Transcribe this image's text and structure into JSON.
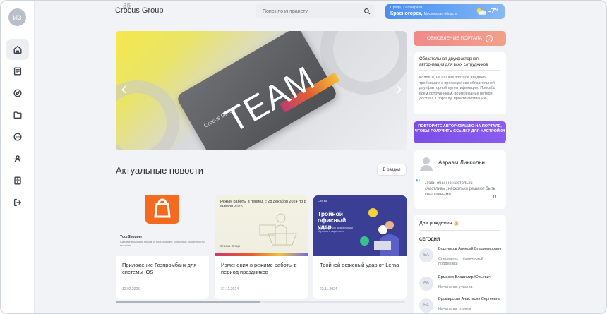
{
  "user": {
    "initials": "ИЗ"
  },
  "sidebar": {
    "items": [
      {
        "icon": "home-icon"
      },
      {
        "icon": "news-icon"
      },
      {
        "icon": "compass-icon"
      },
      {
        "icon": "folder-icon"
      },
      {
        "icon": "chat-icon"
      },
      {
        "icon": "users-icon"
      },
      {
        "icon": "directory-icon"
      },
      {
        "icon": "logout-icon"
      }
    ]
  },
  "header": {
    "logo_text": "Crocus Group",
    "logo_number": "35",
    "search_placeholder": "Поиск по интранету",
    "weather": {
      "date": "Среда, 12 февраля",
      "city": "Красногорск,",
      "region": "Московская область",
      "temp": "-7°"
    }
  },
  "banner": {
    "headline": "TEAM",
    "brand": "Crocus Group"
  },
  "news": {
    "title": "Актуальные новости",
    "section_button": "В раздел",
    "cards": [
      {
        "title": "Приложение Газпромбанк для системы iOS",
        "date": "12.02.2025",
        "image_brand": "YourShopper",
        "image_text": "Сделайте шопинг проще с YourShopper! Ключевые особенности: ssaob.ru"
      },
      {
        "title": "Изменения в режиме работы в период праздников",
        "date": "27.12.2024",
        "image_text": "Режим работы в период с 28 декабря 2024 по 8 января 2025",
        "image_brand": "Crocus Group"
      },
      {
        "title": "Тройной офисный удар от Lerna",
        "date": "22.11.2024",
        "image_brand": "Lerna",
        "image_headline": "Тройной офисный удар",
        "image_text": "Прокачайте soft skills и навыки обучения и маркетинга"
      }
    ]
  },
  "right": {
    "update_button": "ОБНОВЛЕНИЕ ПОРТАЛА",
    "notice": {
      "heading": "Обязательная двухфакторная авторизация для всех сотрудников",
      "body": "Коллеги, на нашем портале введено требование к прохождению обязательной двухфакторной аутентификации. Просьба всем сотрудникам, во избежание потери доступа к порталу, пройти активацию."
    },
    "retry_button": "ПОВТОРИТЕ АВТОРИЗАЦИЮ НА ПОРТАЛЕ, ЧТОБЫ ПОЛУЧИТЬ ССЫЛКУ ДЛЯ НАСТРОЙКИ",
    "quote": {
      "author": "Авраам Линкольн",
      "text": "Люди обычно настолько счастливы, насколько решают быть счастливыми"
    },
    "birthdays": {
      "title": "Дни рождения 🎂",
      "today_label": "СЕГОДНЯ",
      "people": [
        {
          "initials": "БА",
          "name": "Бортников Алексей Владимирович",
          "role": "Специалист технической поддержки"
        },
        {
          "initials": "ЕВ",
          "name": "Ермаков Владимир Юрьевич",
          "role": "Начальник участка"
        },
        {
          "initials": "БА",
          "name": "Бромирская Анастасия Сергеевна",
          "role": "Начальник отдела"
        }
      ]
    }
  },
  "colors": {
    "weather_accent": "#4b8ef0",
    "update_button": "#f08a8a",
    "retry_button": "#7b4ee6",
    "quote_mark": "#4d8ee0"
  }
}
